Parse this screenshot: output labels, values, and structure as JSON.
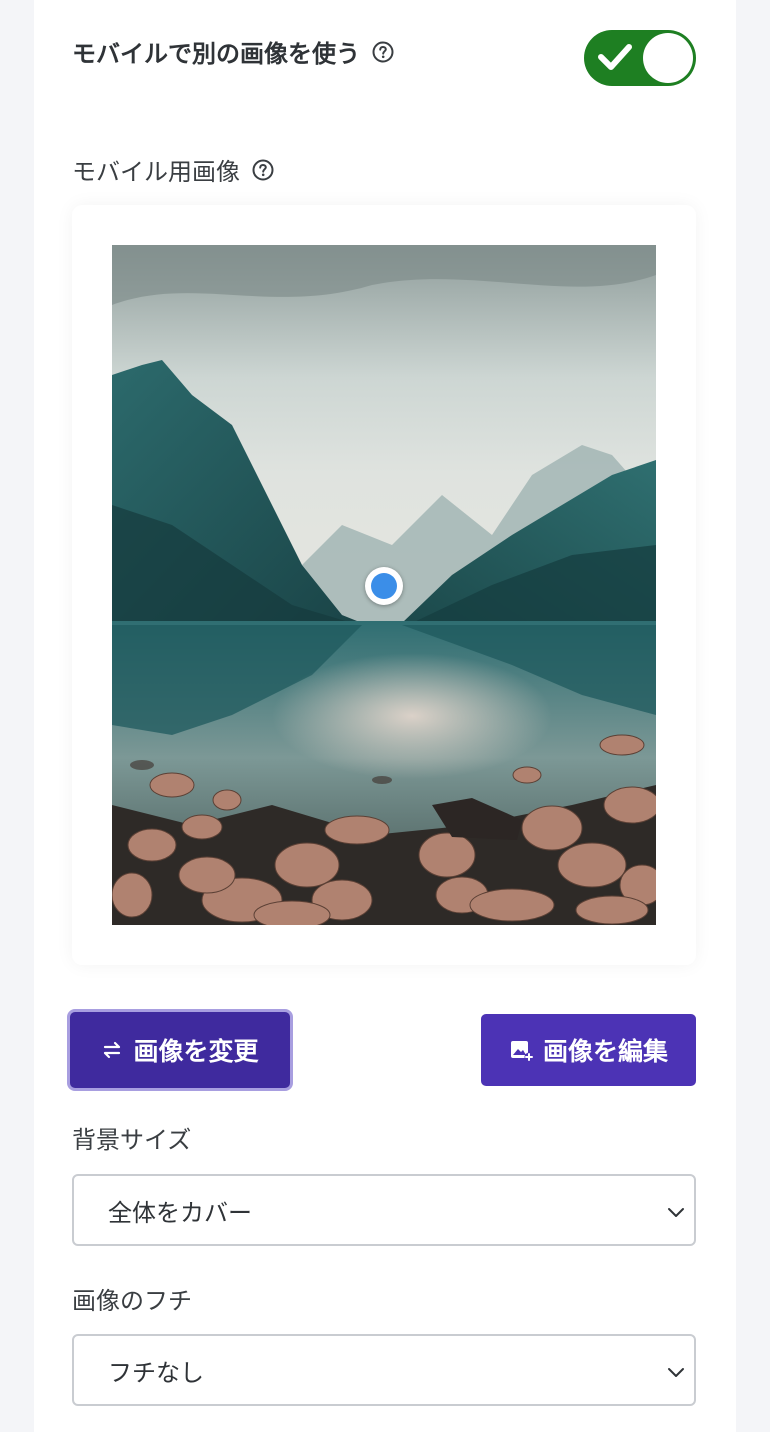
{
  "mobile_toggle": {
    "label": "モバイルで別の画像を使う",
    "enabled": true,
    "on_color": "#1e7f22"
  },
  "mobile_image": {
    "label": "モバイル用画像"
  },
  "buttons": {
    "change_label": "画像を変更",
    "edit_label": "画像を編集"
  },
  "background_size": {
    "label": "背景サイズ",
    "value": "全体をカバー"
  },
  "image_border": {
    "label": "画像のフチ",
    "value": "フチなし"
  },
  "colors": {
    "accent": "#4c33b5",
    "focal_point": "#3b8ee8"
  }
}
